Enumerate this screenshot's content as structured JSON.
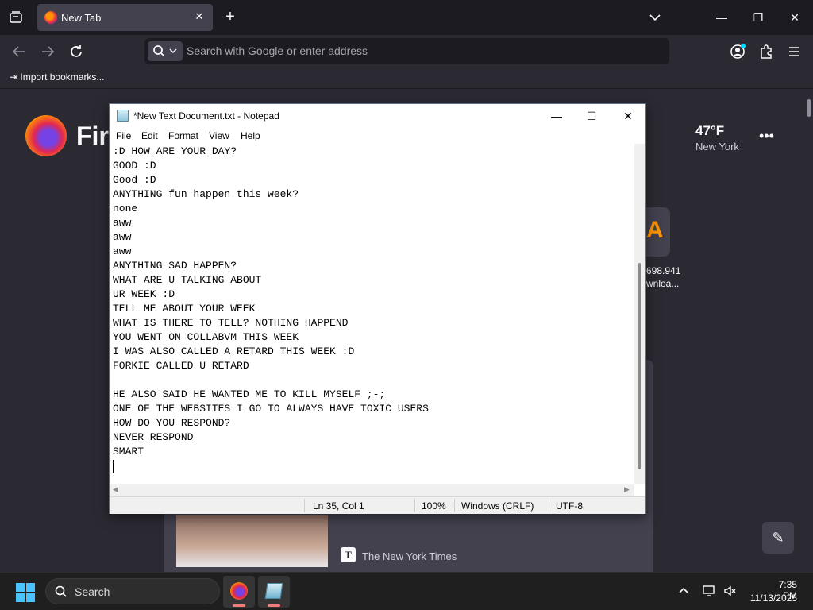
{
  "browser": {
    "tab_title": "New Tab",
    "url_placeholder": "Search with Google or enter address",
    "bookmark_item": "Import bookmarks...",
    "wordmark": "Fir"
  },
  "newtab": {
    "weather_temp": "47°F",
    "weather_city": "New York",
    "shortcut_label_1": "698.941",
    "shortcut_label_2": "wnloa...",
    "story_source": "The New York Times",
    "story_source_icon": "T"
  },
  "notepad": {
    "title": "*New Text Document.txt - Notepad",
    "menu": [
      "File",
      "Edit",
      "Format",
      "View",
      "Help"
    ],
    "lines": [
      ":D HOW ARE YOUR DAY?",
      "GOOD :D",
      "Good :D",
      "ANYTHING fun happen this week?",
      "none",
      "aww",
      "aww",
      "aww",
      "ANYTHING SAD HAPPEN?",
      "WHAT ARE U TALKING ABOUT",
      "UR WEEK :D",
      "TELL ME ABOUT YOUR WEEK",
      "WHAT IS THERE TO TELL? NOTHING HAPPEND",
      "YOU WENT ON COLLABVM THIS WEEK",
      "I WAS ALSO CALLED A RETARD THIS WEEK :D",
      "FORKIE CALLED U RETARD",
      "",
      "HE ALSO SAID HE WANTED ME TO KILL MYSELF ;-;",
      "ONE OF THE WEBSITES I GO TO ALWAYS HAVE TOXIC USERS",
      "HOW DO YOU RESPOND?",
      "NEVER RESPOND",
      "SMART",
      ""
    ],
    "status": {
      "position": "Ln 35, Col 1",
      "zoom": "100%",
      "line_ending": "Windows (CRLF)",
      "encoding": "UTF-8"
    }
  },
  "taskbar": {
    "search_label": "Search",
    "time": "7:35 PM",
    "date": "11/13/2025"
  },
  "icons": {
    "tab_list": "tab-list-icon",
    "search": "search-icon",
    "account": "account-icon",
    "extensions": "puzzle-icon",
    "menu": "hamburger-icon",
    "edit": "pencil-icon"
  }
}
